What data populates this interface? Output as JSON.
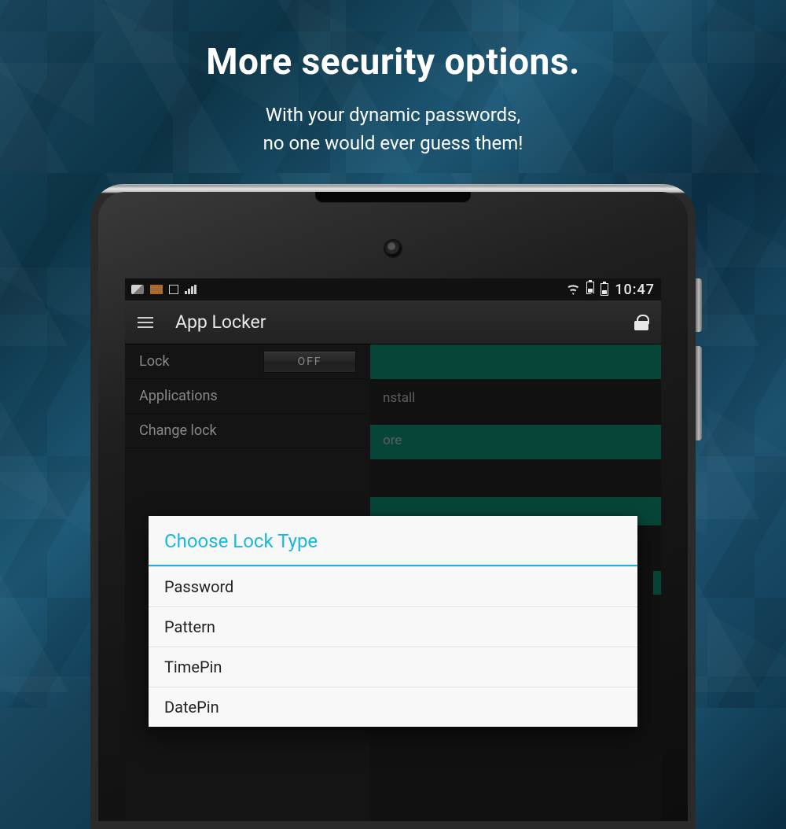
{
  "hero": {
    "title": "More security options.",
    "line1": "With your dynamic passwords,",
    "line2": "no one would ever guess them!"
  },
  "status": {
    "time": "10:47"
  },
  "actionbar": {
    "title": "App Locker"
  },
  "sidebar": {
    "items": [
      {
        "label": "Lock",
        "badge": "OFF"
      },
      {
        "label": "Applications"
      },
      {
        "label": "Change lock"
      }
    ]
  },
  "bg_labels": {
    "install": "nstall",
    "store": "ore"
  },
  "dialog": {
    "title": "Choose Lock Type",
    "options": [
      "Password",
      "Pattern",
      "TimePin",
      "DatePin"
    ]
  }
}
